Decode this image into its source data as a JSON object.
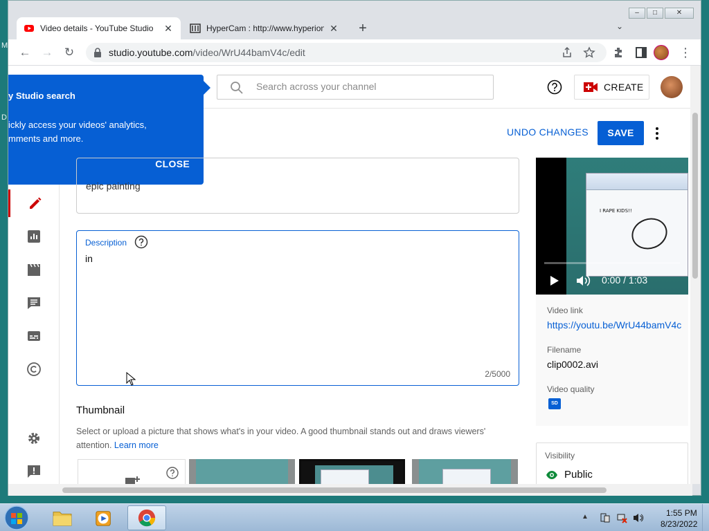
{
  "desktop": {
    "left_letters": [
      "M",
      "D"
    ]
  },
  "browser": {
    "tabs": [
      {
        "title": "Video details - YouTube Studio",
        "active": true
      },
      {
        "title": "HyperCam : http://www.hyperionic",
        "active": false
      }
    ],
    "url_host": "studio.youtube.com",
    "url_path": "/video/WrU44bamV4c/edit"
  },
  "header": {
    "search_placeholder": "Search across your channel",
    "create_label": "CREATE"
  },
  "popup": {
    "title": "y Studio search",
    "body": "ickly access your videos' analytics, mments and more.",
    "close_label": "CLOSE"
  },
  "actions": {
    "undo_label": "UNDO CHANGES",
    "save_label": "SAVE"
  },
  "form": {
    "title_value": "epic painting",
    "description_label": "Description",
    "description_value": "in",
    "description_count": "2/5000",
    "thumbnail_heading": "Thumbnail",
    "thumbnail_desc": "Select or upload a picture that shows what's in your video. A good thumbnail stands out and draws viewers' attention.",
    "learn_more": "Learn more"
  },
  "video": {
    "overlay_text": "I RAPE KIDS!!",
    "time": "0:00 / 1:03",
    "progress_fraction": 0.0
  },
  "info": {
    "link_label": "Video link",
    "link_value": "https://youtu.be/WrU44bamV4c",
    "filename_label": "Filename",
    "filename_value": "clip0002.avi",
    "quality_label": "Video quality",
    "quality_badge": "SD",
    "visibility_label": "Visibility",
    "visibility_value": "Public"
  },
  "taskbar": {
    "time": "1:55 PM",
    "date": "8/23/2022"
  },
  "colors": {
    "accent": "#065fd4",
    "brand_red": "#cc0000",
    "desktop": "#1d7a7a"
  }
}
